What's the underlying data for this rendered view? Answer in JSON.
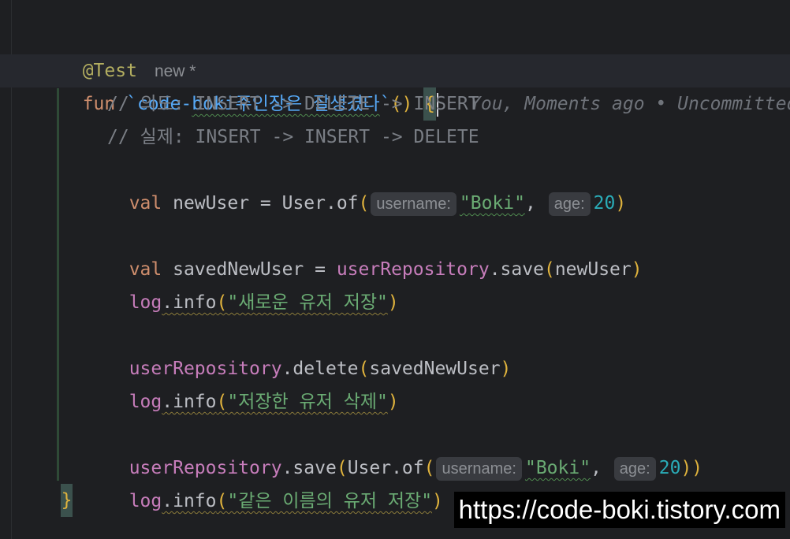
{
  "editor": {
    "annotation": "@Test",
    "annotation_hint": "new *",
    "fun_keyword": "fun",
    "fun_name_prefix": "`code-",
    "fun_name_squiggly": "boki주인장은 잘생겼다",
    "fun_name_suffix": "`",
    "fun_parens": "()",
    "open_brace": "{",
    "blame": "You, Moments ago • Uncommitted",
    "comment1": "// 의도: INSERT -> DELETE -> INSERT",
    "comment2": "// 실제: INSERT -> INSERT -> DELETE",
    "val": "val",
    "new_user_var": "newUser",
    "eq": " = ",
    "user_class": "User",
    "of_call": ".of",
    "open_paren": "(",
    "close_paren": ")",
    "hint_username": "username:",
    "hint_age": "age:",
    "str_boki": "\"Boki\"",
    "comma": ",",
    "age_value": "20",
    "saved_new_user_var": "savedNewUser",
    "user_repository": "userRepository",
    "save_method": ".save",
    "delete_method": ".delete",
    "log": "log",
    "info_method": ".info",
    "log_msg1": "\"새로운 유저 저장\"",
    "log_msg2": "\"저장한 유저 삭제\"",
    "log_msg3": "\"같은 이름의 유저 저장\"",
    "close_brace": "}"
  },
  "watermark": "https://code-boki.tistory.com"
}
